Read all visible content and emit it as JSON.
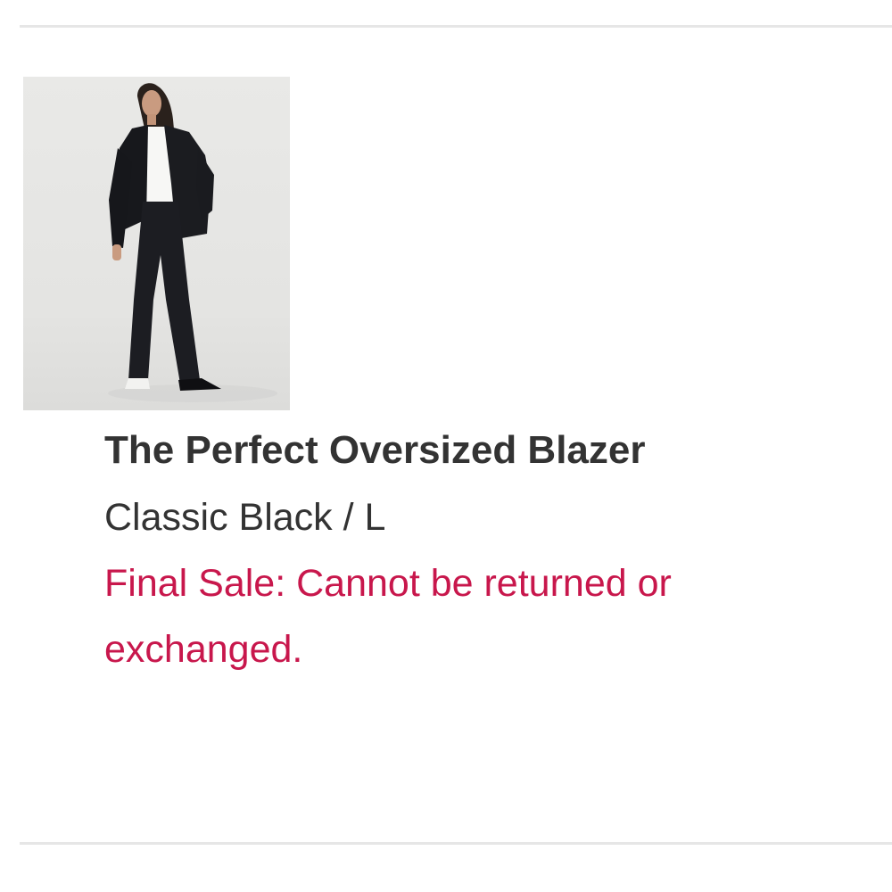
{
  "product": {
    "image_alt": "Model wearing black oversized blazer and wide-leg trousers",
    "title": "The Perfect Oversized Blazer",
    "variant": "Classic Black / L",
    "notice": "Final Sale: Cannot be returned or exchanged."
  },
  "colors": {
    "title_text": "#333333",
    "variant_text": "#333333",
    "notice_text": "#c8174c",
    "divider": "#e6e6e6"
  }
}
